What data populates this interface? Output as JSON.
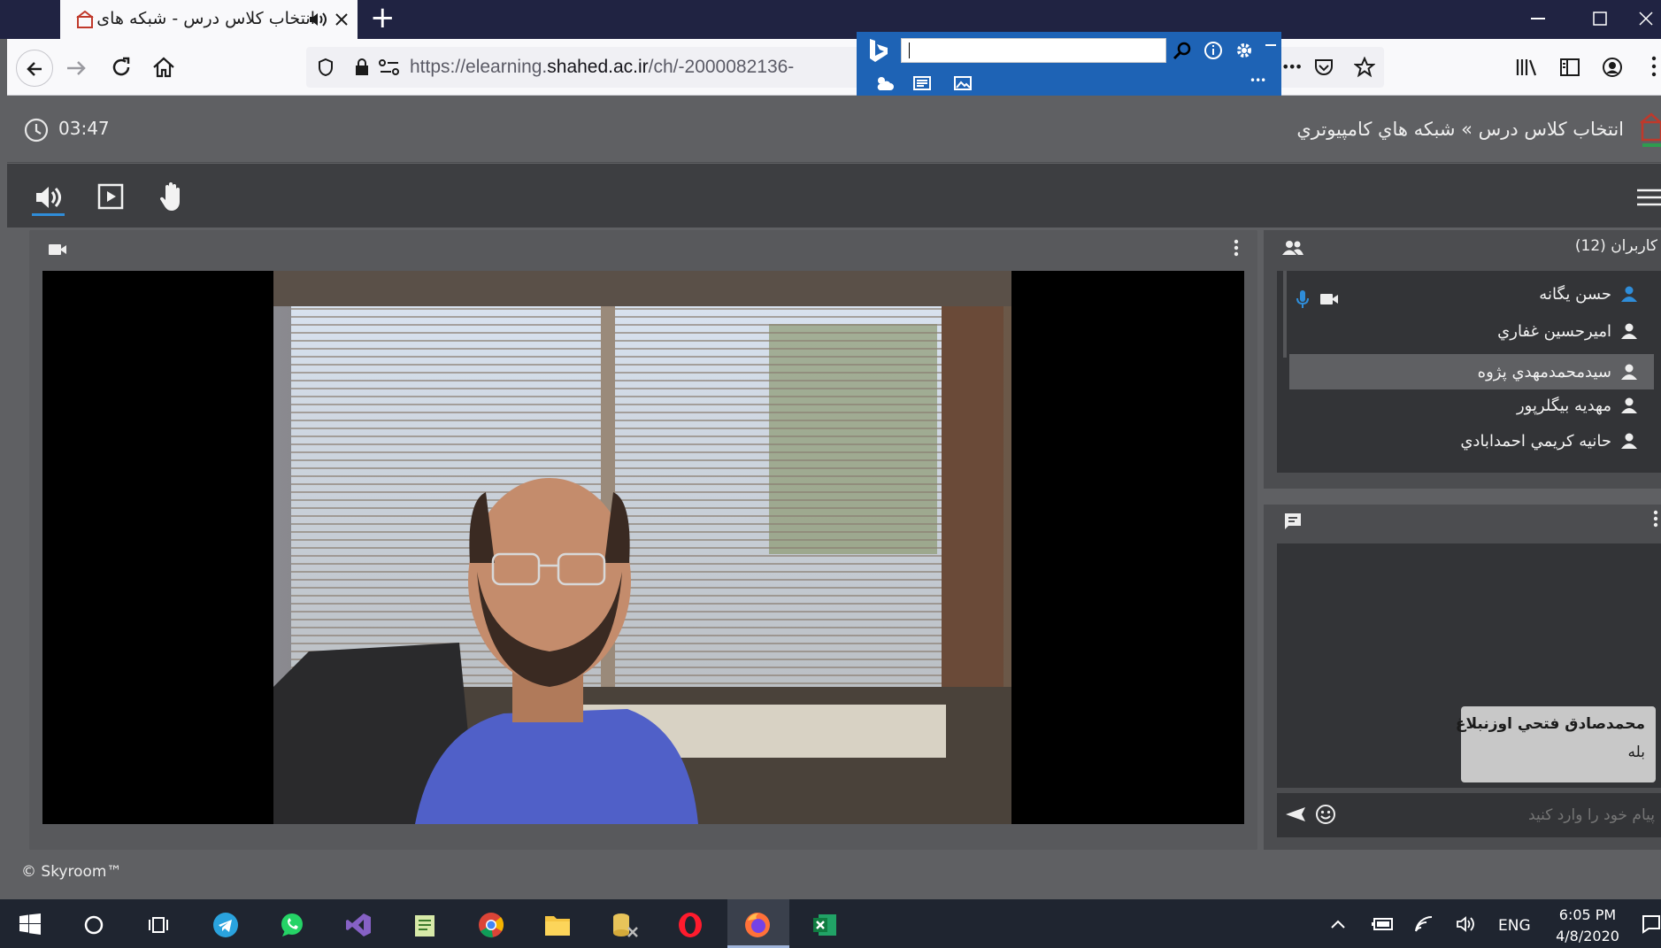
{
  "browser": {
    "tab_title": "انتخاب کلاس درس - شبکه های",
    "url_prefix": "https://elearning.",
    "url_domain": "shahed.ac.ir",
    "url_path": "/ch/-2000082136-",
    "new_tab_label": "+",
    "overflow_label": "•••"
  },
  "header": {
    "timer": "03:47",
    "breadcrumb": "انتخاب کلاس درس » شبکه هاي کامپيوتري"
  },
  "users": {
    "title": "کاربران (12)",
    "list": [
      {
        "name": "حسن يگانه"
      },
      {
        "name": "اميرحسين غفاري"
      },
      {
        "name": "سيدمحمدمهدي پژوه"
      },
      {
        "name": "مهديه بيگلرپور"
      },
      {
        "name": "حانيه کريمي احمدابادي"
      }
    ]
  },
  "chat": {
    "message_author": "محمدصادق فتحي اوزنبلاغ",
    "message_text": "بله",
    "input_placeholder": "پيام خود را وارد کنيد"
  },
  "footer": {
    "copyright": "© Skyroom™"
  },
  "taskbar": {
    "language": "ENG",
    "time": "6:05 PM",
    "date": "4/8/2020"
  },
  "colors": {
    "titlebar": "#202342",
    "bing": "#1e63b5",
    "page_bg": "#5f6063",
    "panel_dark": "#333437",
    "accent_blue": "#2f8dd9"
  }
}
